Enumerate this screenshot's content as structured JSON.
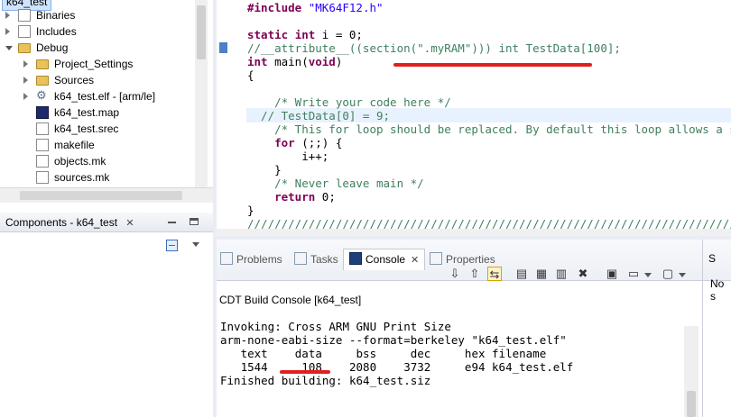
{
  "explorer": {
    "top_item": "k64_test",
    "items": [
      {
        "label": "Binaries",
        "icon": "binaries-icon",
        "indent": 1,
        "twisty": "closed"
      },
      {
        "label": "Includes",
        "icon": "includes-icon",
        "indent": 1,
        "twisty": "closed"
      },
      {
        "label": "Debug",
        "icon": "folder-icon",
        "indent": 1,
        "twisty": "open"
      },
      {
        "label": "Project_Settings",
        "icon": "folder-icon",
        "indent": 2,
        "twisty": "closed"
      },
      {
        "label": "Sources",
        "icon": "folder-icon",
        "indent": 2,
        "twisty": "closed"
      },
      {
        "label": "k64_test.elf - [arm/le]",
        "icon": "gear-icon",
        "indent": 2,
        "twisty": "closed"
      },
      {
        "label": "k64_test.map",
        "icon": "map-file-icon",
        "indent": 2,
        "twisty": "none"
      },
      {
        "label": "k64_test.srec",
        "icon": "file-icon",
        "indent": 2,
        "twisty": "none"
      },
      {
        "label": "makefile",
        "icon": "makefile-icon",
        "indent": 2,
        "twisty": "none"
      },
      {
        "label": "objects.mk",
        "icon": "makefile-icon",
        "indent": 2,
        "twisty": "none"
      },
      {
        "label": "sources.mk",
        "icon": "makefile-icon",
        "indent": 2,
        "twisty": "none"
      }
    ]
  },
  "components": {
    "tab_label": "Components - k64_test",
    "close": "✕"
  },
  "editor": {
    "lines": [
      "#include \"MK64F12.h\"",
      "",
      "static int i = 0;",
      "//__attribute__((section(\".myRAM\"))) int TestData[100];",
      "int main(void)",
      "{",
      "",
      "    /* Write your code here */",
      "  // TestData[0] = 9;",
      "    /* This for loop should be replaced. By default this loop allows a single",
      "    for (;;) {",
      "        i++;",
      "    }",
      "    /* Never leave main */",
      "    return 0;",
      "}",
      "////////////////////////////////////////////////////////////////////////"
    ]
  },
  "bottom": {
    "tabs": [
      {
        "label": "Problems",
        "icon": "problems-icon"
      },
      {
        "label": "Tasks",
        "icon": "tasks-icon"
      },
      {
        "label": "Console",
        "icon": "console-icon",
        "active": true,
        "close": "✕"
      },
      {
        "label": "Properties",
        "icon": "properties-icon"
      }
    ],
    "console_title": "CDT Build Console [k64_test]",
    "console_lines": [
      "Invoking: Cross ARM GNU Print Size",
      "arm-none-eabi-size --format=berkeley \"k64_test.elf\"",
      "   text    data     bss     dec     hex filename",
      "   1544     108    2080    3732     e94 k64_test.elf",
      "Finished building: k64_test.siz"
    ]
  },
  "right_panel": {
    "label_partial": "S",
    "text_partial": "No s"
  },
  "colors": {
    "keyword": "#7f0055",
    "string": "#2a00ff",
    "comment": "#3f7f5f",
    "annotation_red": "#e02020"
  }
}
